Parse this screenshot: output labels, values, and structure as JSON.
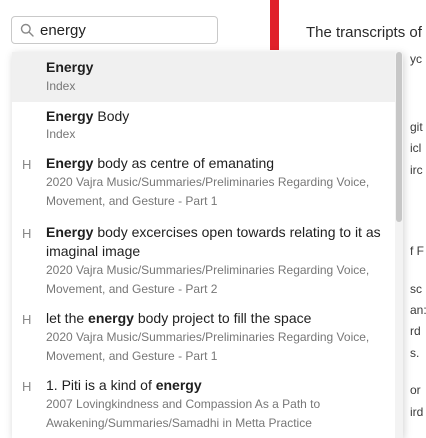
{
  "search": {
    "value": "energy",
    "icon": "search-icon"
  },
  "note": {
    "title": "The transcripts of",
    "fragments": [
      "yc",
      "git",
      "icl",
      "irc",
      "f F",
      "sc",
      "an:",
      "rd",
      "s.",
      "or",
      "ird"
    ]
  },
  "suggestions": [
    {
      "type": "",
      "title_bold": "Energy",
      "title_rest": "",
      "path": "Index"
    },
    {
      "type": "",
      "title_bold": "Energy",
      "title_rest": " Body",
      "path": "Index"
    },
    {
      "type": "H",
      "title_bold": "Energy",
      "title_rest": " body as centre of emanating",
      "path": "2020 Vajra Music/Summaries/Preliminaries Regarding Voice, Movement, and Gesture - Part 1"
    },
    {
      "type": "H",
      "title_bold": "Energy",
      "title_rest": " body excercises open towards relating to it as imaginal image",
      "path": "2020 Vajra Music/Summaries/Preliminaries Regarding Voice, Movement, and Gesture - Part 2"
    },
    {
      "type": "H",
      "title_pre": "let the ",
      "title_bold": "energy",
      "title_rest": " body project to fill the space",
      "path": "2020 Vajra Music/Summaries/Preliminaries Regarding Voice, Movement, and Gesture - Part 1"
    },
    {
      "type": "H",
      "title_pre": "1. Piti is a kind of ",
      "title_bold": "energy",
      "title_rest": "",
      "path": "2007 Lovingkindness and Compassion As a Path to Awakening/Summaries/Samadhi in Metta Practice"
    }
  ],
  "colors": {
    "accent_bar": "#e0202a"
  }
}
